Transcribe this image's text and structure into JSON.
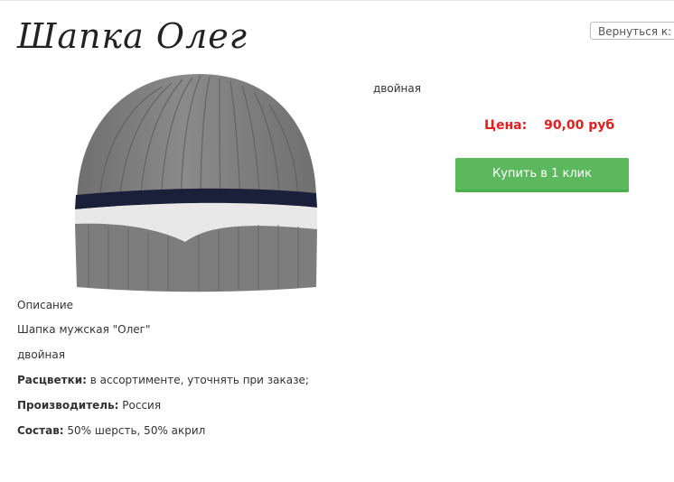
{
  "product": {
    "title": "Шапка Олег",
    "short_description": "двойная",
    "price_label": "Цена:",
    "price_value": "90,00 руб",
    "buy_button": "Купить в 1 клик"
  },
  "navigation": {
    "back_select": "Вернуться к: Муж"
  },
  "description": {
    "heading": "Описание",
    "name_line": "Шапка мужская \"Олег\"",
    "type_line": "двойная",
    "colors_label": "Расцветки:",
    "colors_value": " в ассортименте, уточнять при заказе;",
    "maker_label": "Производитель:",
    "maker_value": " Россия",
    "composition_label": "Состав:",
    "composition_value": " 50% шерсть, 50% акрил"
  },
  "colors": {
    "accent_price": "#e02020",
    "buy_button": "#5cb85c"
  }
}
